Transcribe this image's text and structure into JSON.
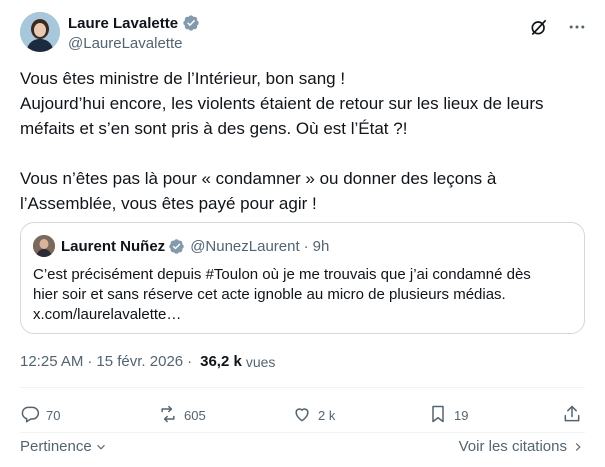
{
  "author": {
    "name": "Laure Lavalette",
    "handle": "@LaureLavalette"
  },
  "tweet": {
    "lines_p1": [
      "Vous êtes ministre de l’Intérieur, bon sang !",
      "Aujourd’hui encore, les violents étaient de retour sur les lieux de leurs",
      "méfaits et s’en sont pris à des gens. Où est l’État ?!"
    ],
    "lines_p2": [
      "Vous n’êtes pas là pour « condamner » ou donner des leçons à",
      "l’Assemblée, vous êtes payé pour agir !"
    ]
  },
  "quote": {
    "name": "Laurent Nuñez",
    "handle": "@NunezLaurent",
    "dot": "·",
    "time": "9h",
    "lines": [
      "C’est précisément depuis #Toulon où je me trouvais que j’ai condamné dès",
      "hier soir et sans réserve cet acte ignoble au micro de plusieurs médias.",
      "x.com/laurelavalette…"
    ]
  },
  "meta": {
    "time": "12:25 AM",
    "sep": "·",
    "date": "15 févr. 2026",
    "sep2": "·",
    "views_count": "36,2 k",
    "views_label": "vues"
  },
  "actions": {
    "replies": "70",
    "reposts": "605",
    "likes": "2 k",
    "bookmarks": "19"
  },
  "footer": {
    "sort_label": "Pertinence",
    "quotes_label": "Voir les citations"
  },
  "icons": {
    "verified": "verified-badge-icon",
    "grok": "grok-icon",
    "more": "more-icon",
    "reply": "reply-icon",
    "repost": "repost-icon",
    "like": "like-icon",
    "bookmark": "bookmark-icon",
    "share": "share-icon"
  },
  "colors": {
    "text": "#0f1419",
    "secondary": "#536471",
    "border": "#cfd9de",
    "divider": "#eff3f4"
  }
}
